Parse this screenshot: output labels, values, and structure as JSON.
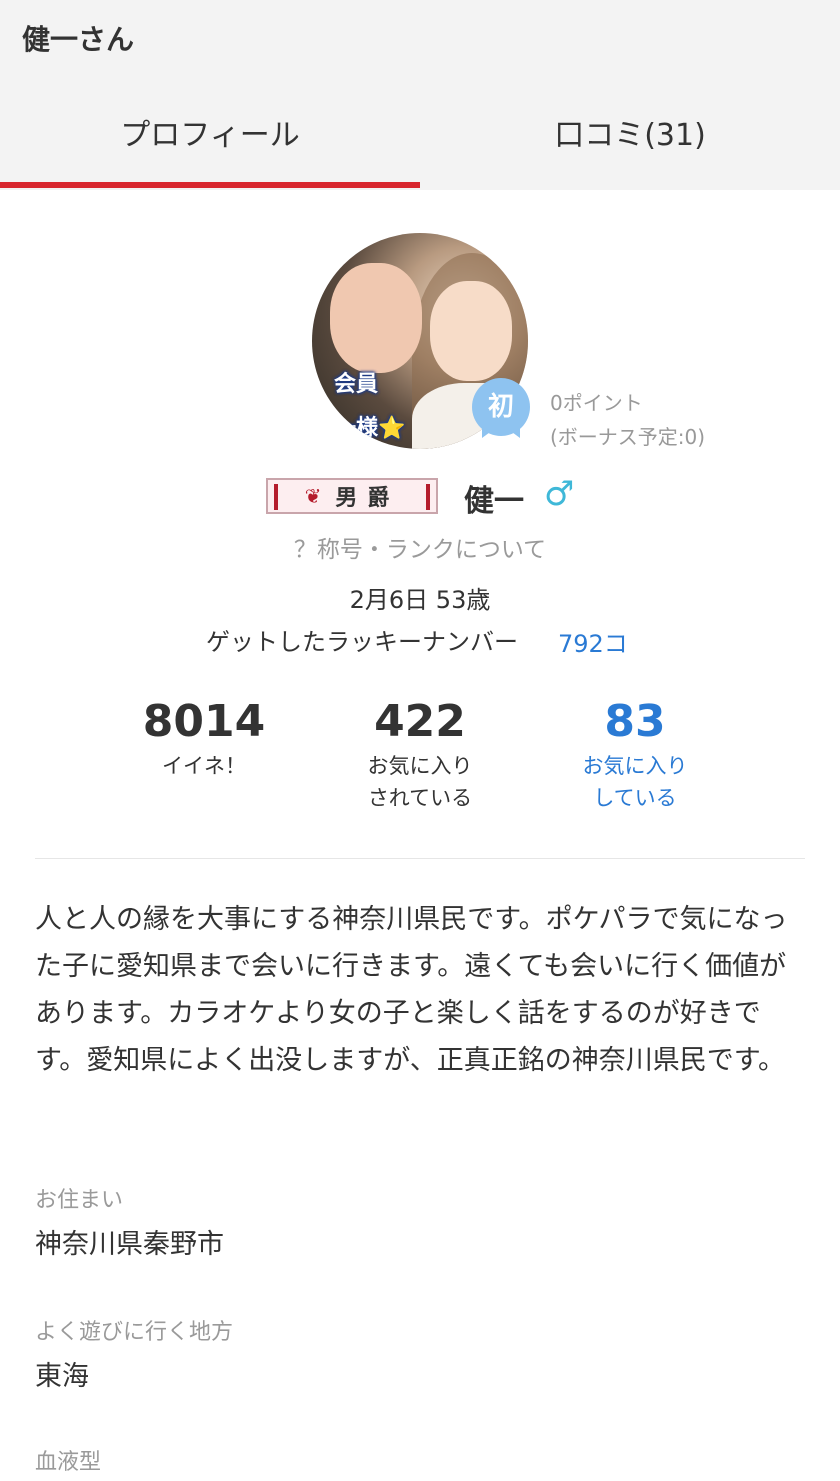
{
  "header": {
    "title": "健一さん"
  },
  "tabs": [
    {
      "label": "プロフィール",
      "active": true
    },
    {
      "label": "口コミ(31)",
      "active": false
    }
  ],
  "colors": {
    "accent": "#d8262e",
    "link": "#2a7ad4",
    "gender": "#3fb8d8",
    "badge": "#8ec3f0"
  },
  "profile": {
    "avatar_overlay": [
      "会員",
      "一様⭐"
    ],
    "badge": "初",
    "points": "0ポイント",
    "bonus": "(ボーナス予定:0)",
    "rank_title": "男爵",
    "rank_emblem": "❦",
    "name": "健一",
    "gender_icon": "♂",
    "rank_link": "？称号・ランクについて",
    "birthday": "2月6日 53歳",
    "lucky_label": "ゲットしたラッキーナンバー",
    "lucky_count": "792コ"
  },
  "stats": [
    {
      "value": "8014",
      "label1": "イイネ！",
      "label2": ""
    },
    {
      "value": "422",
      "label1": "お気に入り",
      "label2": "されている"
    },
    {
      "value": "83",
      "label1": "お気に入り",
      "label2": "している"
    }
  ],
  "bio": "人と人の縁を大事にする神奈川県民です。ポケパラで気になった子に愛知県まで会いに行きます。遠くても会いに行く価値があります。カラオケより女の子と楽しく話をするのが好きです。愛知県によく出没しますが、正真正銘の神奈川県民です。",
  "fields": {
    "residence_label": "お住まい",
    "residence_value": "神奈川県秦野市",
    "area_label": "よく遊びに行く地方",
    "area_value": "東海",
    "blood_label": "血液型"
  }
}
